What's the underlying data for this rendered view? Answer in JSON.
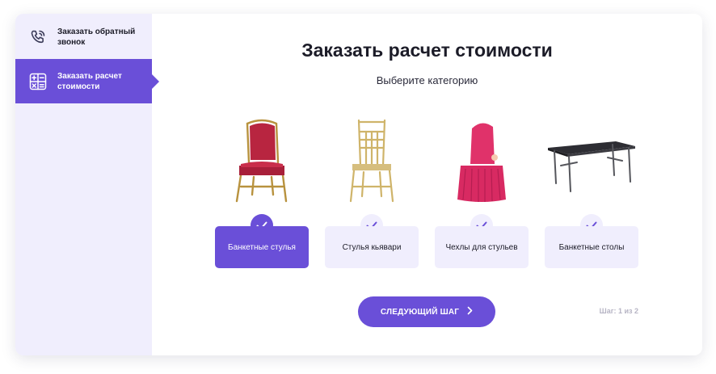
{
  "sidebar": {
    "items": [
      {
        "label": "Заказать обратный звонок",
        "icon": "phone-call-icon",
        "active": false
      },
      {
        "label": "Заказать расчет стоимости",
        "icon": "calculator-icon",
        "active": true
      }
    ]
  },
  "main": {
    "title": "Заказать расчет стоимости",
    "subtitle": "Выберите категорию",
    "categories": [
      {
        "label": "Банкетные стулья",
        "icon": "banquet-chair-image",
        "selected": true
      },
      {
        "label": "Стулья кьявари",
        "icon": "chiavari-chair-image",
        "selected": false
      },
      {
        "label": "Чехлы для стульев",
        "icon": "chair-cover-image",
        "selected": false
      },
      {
        "label": "Банкетные столы",
        "icon": "banquet-table-image",
        "selected": false
      }
    ],
    "next_button": "СЛЕДУЮЩИЙ ШАГ",
    "step": "Шаг: 1 из 2"
  },
  "colors": {
    "accent": "#6a4fd8",
    "accent_light": "#f0eefd",
    "text": "#1c1c28",
    "muted": "#b6b4c4"
  }
}
